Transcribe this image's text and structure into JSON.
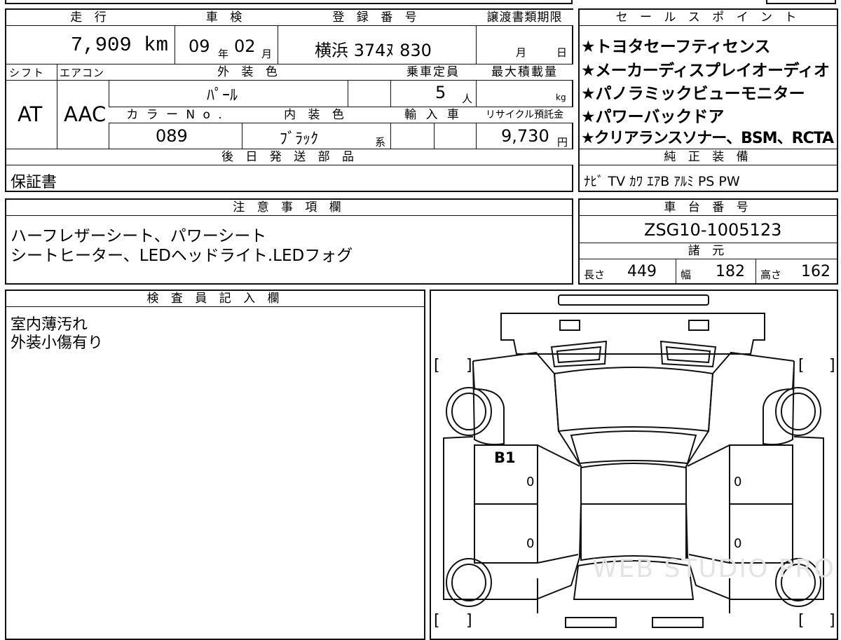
{
  "vehicle": {
    "mileage_label": "走 行",
    "mileage_value": "7,909 km",
    "inspection_label": "車 検",
    "inspection_year": "09",
    "year_unit": "年",
    "inspection_month": "02",
    "month_unit": "月",
    "reg_label": "登 録 番 号",
    "reg_value": "横浜 374ﾇ 830",
    "transfer_label": "譲渡書類期限",
    "transfer_month": "月",
    "transfer_day": "日",
    "shift_label": "シフト",
    "shift_value": "AT",
    "ac_label": "エアコン",
    "ac_value": "AAC",
    "exterior_label": "外 装 色",
    "exterior_value": "ﾊﾟｰﾙ",
    "capacity_label": "乗車定員",
    "capacity_value": "5",
    "capacity_unit": "人",
    "maxload_label": "最大積載量",
    "maxload_unit": "kg",
    "color_no_label": "カ ラ ー N o .",
    "color_no_value": "089",
    "interior_label": "内 装 色",
    "interior_value": "ﾌﾞﾗｯｸ",
    "interior_suffix": "系",
    "import_label": "輸 入 車",
    "recycle_label": "リサイクル預託金",
    "recycle_value": "9,730",
    "recycle_unit": "円",
    "later_label": "後 日 発 送 部 品",
    "later_value": "保証書"
  },
  "sales": {
    "label": "セ ー ル ス ポ イ ン ト",
    "points": [
      "★トヨタセーフティセンス",
      "★メーカーディスプレイオーディオ",
      "★パノラミックビューモニター",
      "★パワーバックドア",
      "★クリアランスソナー、BSM、RCTA"
    ]
  },
  "equipment": {
    "label": "純 正 装 備",
    "value": "ﾅﾋﾞ TV ｶﾜ ｴｱB ｱﾙﾐ PS PW"
  },
  "notes": {
    "label": "注 意 事 項 欄",
    "lines": [
      "ハーフレザーシート、パワーシート",
      "シートヒーター、LEDヘッドライト.LEDフォグ"
    ]
  },
  "chassis": {
    "label": "車 台 番 号",
    "value": "ZSG10-1005123"
  },
  "specs": {
    "label": "諸 元",
    "length_label": "長さ",
    "length_value": "449",
    "width_label": "幅",
    "width_value": "182",
    "height_label": "高さ",
    "height_value": "162"
  },
  "inspector": {
    "label": "検 査 員 記 入 欄",
    "lines": [
      "室内薄汚れ",
      "外装小傷有り"
    ]
  },
  "diagram": {
    "marks": {
      "front_left_door": "B1",
      "front_left_num": "0",
      "rear_left_num": "0",
      "front_right_num": "0",
      "rear_right_num": "0"
    },
    "bracket_open": "[",
    "bracket_close": "]",
    "watermark": "WEB STUDIO PRO"
  }
}
